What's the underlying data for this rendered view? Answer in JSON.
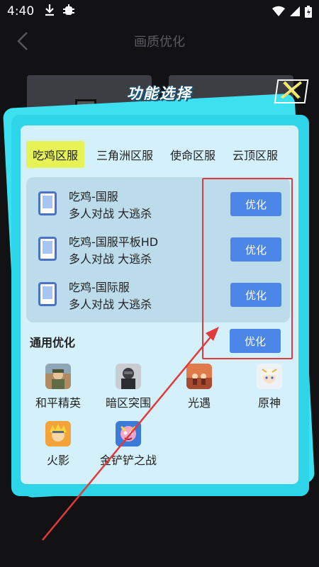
{
  "status_bar": {
    "time": "4:40"
  },
  "background_page": {
    "title": "画质优化"
  },
  "dialog": {
    "title": "功能选择",
    "tabs": [
      {
        "label": "吃鸡区服",
        "active": true
      },
      {
        "label": "三角洲区服",
        "active": false
      },
      {
        "label": "使命区服",
        "active": false
      },
      {
        "label": "云顶区服",
        "active": false
      }
    ],
    "games": [
      {
        "name": "吃鸡-国服",
        "tags": "多人对战   大逃杀",
        "button": "优化"
      },
      {
        "name": "吃鸡-国服平板HD",
        "tags": "多人对战   大逃杀",
        "button": "优化"
      },
      {
        "name": "吃鸡-国际服",
        "tags": "多人对战   大逃杀",
        "button": "优化"
      }
    ],
    "general": {
      "title": "通用优化",
      "button": "优化"
    },
    "apps": [
      {
        "label": "和平精英"
      },
      {
        "label": "暗区突围"
      },
      {
        "label": "光遇"
      },
      {
        "label": "原神"
      },
      {
        "label": "火影"
      },
      {
        "label": "金铲铲之战"
      }
    ]
  },
  "colors": {
    "accent_button": "#4c86e6",
    "active_tab": "#e6f256",
    "panel": "#2ed5e8",
    "annotation": "#e23a3a"
  }
}
